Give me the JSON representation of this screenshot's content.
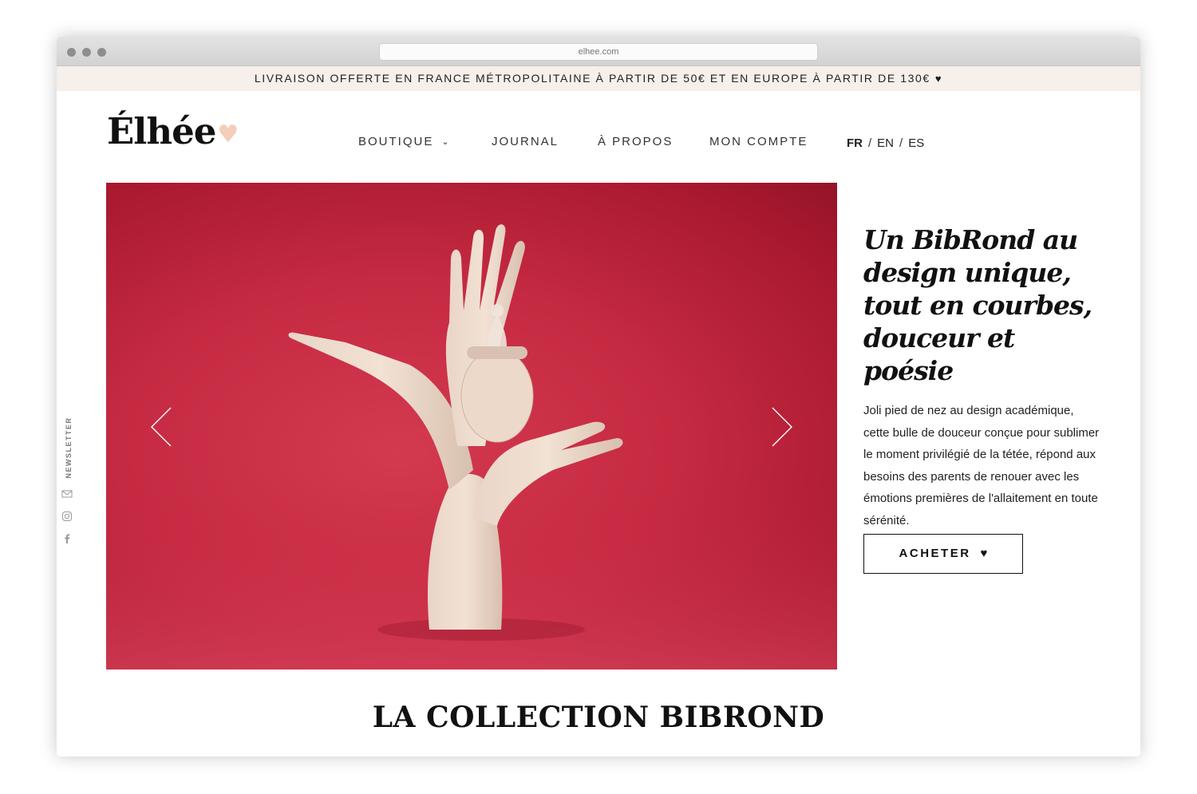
{
  "browser": {
    "url": "elhee.com"
  },
  "promo_bar": {
    "text": "LIVRAISON OFFERTE EN FRANCE MÉTROPOLITAINE À PARTIR DE 50€ ET EN EUROPE À PARTIR DE 130€",
    "icon": "heart-icon"
  },
  "header": {
    "logo": "Élhée",
    "nav": [
      {
        "label": "BOUTIQUE",
        "has_dropdown": true
      },
      {
        "label": "JOURNAL"
      },
      {
        "label": "À PROPOS"
      },
      {
        "label": "MON COMPTE"
      }
    ],
    "languages": [
      "FR",
      "EN",
      "ES"
    ],
    "active_language": "FR",
    "lang_separator": "/"
  },
  "sidebar": {
    "label": "NEWSLETTER",
    "icons": [
      "mail-icon",
      "instagram-icon",
      "facebook-icon"
    ]
  },
  "hero": {
    "headline": "Un BibRond au design unique, tout en courbes, douceur et poésie",
    "description": "Joli pied de nez au design académique, cette bulle de douceur conçue pour sublimer le moment privilégié de la tétée, répond aux besoins des parents de renouer avec les émotions premières de l'allaitement en toute sérénité.",
    "cta_label": "ACHETER",
    "background_color": "#c52a42"
  },
  "section": {
    "title": "LA COLLECTION BIBROND"
  }
}
